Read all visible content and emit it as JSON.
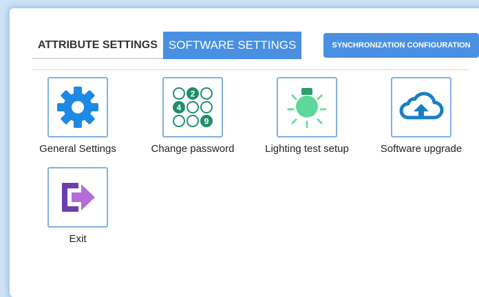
{
  "tabs": [
    {
      "label": "ATTRIBUTE SETTINGS",
      "active": false
    },
    {
      "label": "SOFTWARE SETTINGS",
      "active": true
    }
  ],
  "sync_button": {
    "label": "SYNCHRONIZATION CONFIGURATION"
  },
  "tiles": [
    {
      "label": "General Settings",
      "icon": "gear-icon"
    },
    {
      "label": "Change password",
      "icon": "keypad-icon",
      "keypad_digits": [
        "2",
        "4",
        "9"
      ]
    },
    {
      "label": "Lighting test setup",
      "icon": "light-bulb-icon"
    },
    {
      "label": "Software upgrade",
      "icon": "cloud-upload-icon"
    },
    {
      "label": "Exit",
      "icon": "exit-icon"
    }
  ],
  "colors": {
    "accent": "#4a90e2",
    "gear": "#1e88e5",
    "keypad": "#1f8e6e",
    "bulb": "#5ed89a",
    "cloud": "#1a7fc4",
    "exit_arrow": "#b46cd6",
    "exit_frame": "#6a3fae"
  }
}
